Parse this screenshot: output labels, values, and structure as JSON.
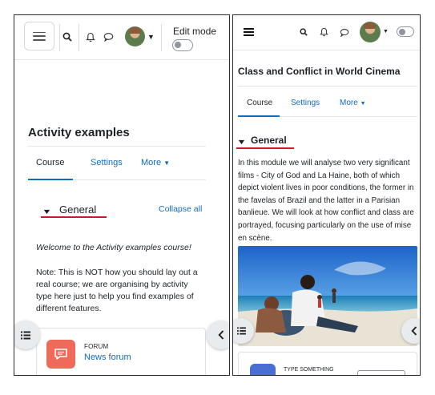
{
  "left": {
    "edit_mode_label": "Edit mode",
    "course_title": "Activity examples",
    "tabs": [
      {
        "label": "Course"
      },
      {
        "label": "Settings"
      },
      {
        "label": "More"
      }
    ],
    "section_title": "General",
    "collapse_all": "Collapse all",
    "welcome_text": "Welcome to the Activity examples course!",
    "note_text": "Note: This is NOT how you should lay out a real course; we are organising by activity type here just to help you find examples of different features.",
    "activity": {
      "type": "FORUM",
      "name": "News forum"
    }
  },
  "right": {
    "course_title": "Class and Conflict in World Cinema",
    "tabs": [
      {
        "label": "Course"
      },
      {
        "label": "Settings"
      },
      {
        "label": "More"
      }
    ],
    "section_title": "General",
    "description": "In this module we will analyse two very significant films - City of God and La Haine, both of which depict violent lives in poor conditions, the former in the favelas of Brazil and the latter in a Parisian banlieue. We will look at how conflict and class are portrayed, focusing particularly on the use of mise en scène.",
    "activity": {
      "type": "TYPE SOMETHING"
    }
  },
  "icons": {
    "menu": "hamburger-icon",
    "search": "search-icon",
    "notifications": "bell-icon",
    "messages": "chat-icon",
    "course_index": "list-icon",
    "drawer": "chevron-left-icon",
    "forum": "forum-icon"
  },
  "colors": {
    "link": "#0f6cbf",
    "section_underline": "#d2142c",
    "forum_icon_bg": "#f06a5a",
    "assignment_icon_bg": "#4a6fd4"
  }
}
